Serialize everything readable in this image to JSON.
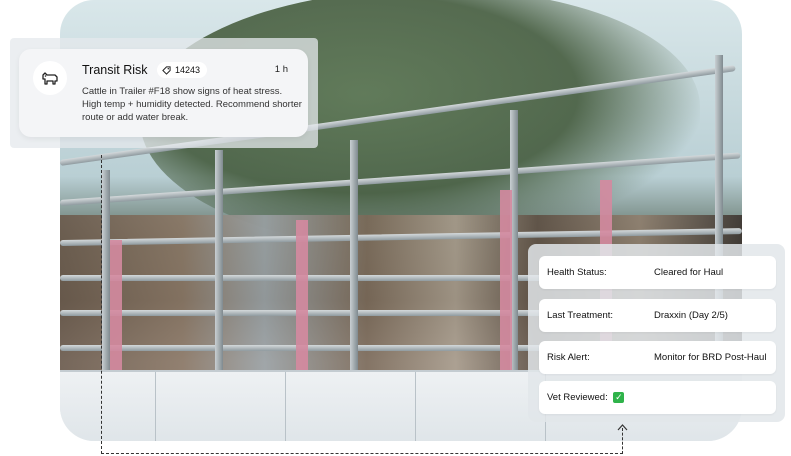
{
  "transit_card": {
    "title": "Transit Risk",
    "tag": "14243",
    "time": "1 h",
    "message": "Cattle in Trailer #F18 show signs of heat stress. High temp + humidity detected. Recommend shorter route or add water break.",
    "avatar_icon": "cow-icon",
    "tag_icon": "tag-icon"
  },
  "status_panel": {
    "health_label": "Health Status:",
    "health_value": "Cleared for Haul",
    "treatment_label": "Last Treatment:",
    "treatment_value": "Draxxin (Day 2/5)",
    "risk_label": "Risk Alert:",
    "risk_value": "Monitor for BRD Post-Haul",
    "vet_label": "Vet Reviewed:",
    "vet_icon": "checkmark-icon",
    "vet_color": "#2fb34a"
  }
}
